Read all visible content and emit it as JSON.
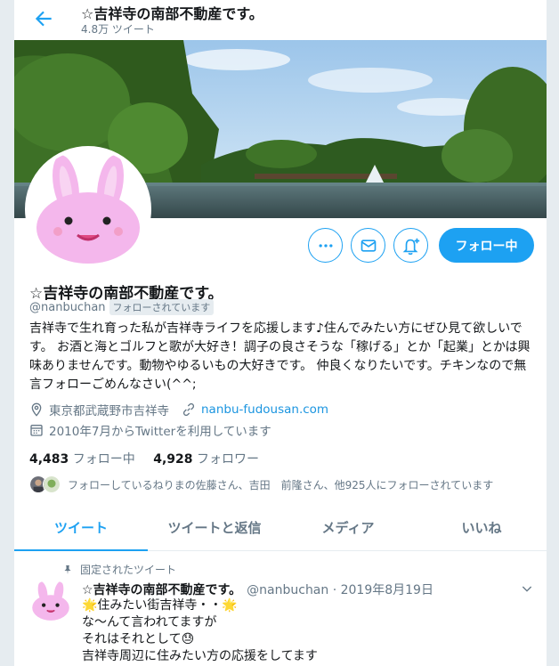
{
  "header": {
    "title": "☆吉祥寺の南部不動産です。",
    "tweet_count": "4.8万 ツイート"
  },
  "profile": {
    "name": "☆吉祥寺の南部不動産です。",
    "handle": "@nanbuchan",
    "follows_you": "フォローされています",
    "bio": "吉祥寺で生れ育った私が吉祥寺ライフを応援します♪住んでみたい方にぜひ見て欲しいです。 お酒と海とゴルフと歌が大好き！調子の良さそうな「稼げる」とか「起業」とかは興味ありませんです。動物やゆるいもの大好きです。 仲良くなりたいです。チキンなので無言フォローごめんなさい(^^;",
    "location": "東京都武蔵野市吉祥寺",
    "website": "nanbu-fudousan.com",
    "joined": "2010年7月からTwitterを利用しています",
    "following_count": "4,483",
    "following_label": "フォロー中",
    "followers_count": "4,928",
    "followers_label": "フォロワー",
    "followed_by": "フォローしているねりまの佐藤さん、吉田　前隆さん、他925人にフォローされています"
  },
  "actions": {
    "more_icon": "more-icon",
    "message_icon": "envelope-icon",
    "notify_icon": "bell-plus-icon",
    "follow_label": "フォロー中"
  },
  "tabs": [
    {
      "label": "ツイート",
      "active": true
    },
    {
      "label": "ツイートと返信",
      "active": false
    },
    {
      "label": "メディア",
      "active": false
    },
    {
      "label": "いいね",
      "active": false
    }
  ],
  "pinned_tweet": {
    "pinned_label": "固定されたツイート",
    "name": "☆吉祥寺の南部不動産です。",
    "handle_date": "@nanbuchan · 2019年8月19日",
    "lines": [
      "🌟住みたい街吉祥寺・・🌟",
      "な〜んて言われてますが",
      "それはそれとして😓",
      "吉祥寺周辺に住みたい方の応援をしてます"
    ]
  },
  "colors": {
    "accent": "#1da1f2",
    "link": "#1b95e0",
    "secondary_text": "#657786"
  }
}
